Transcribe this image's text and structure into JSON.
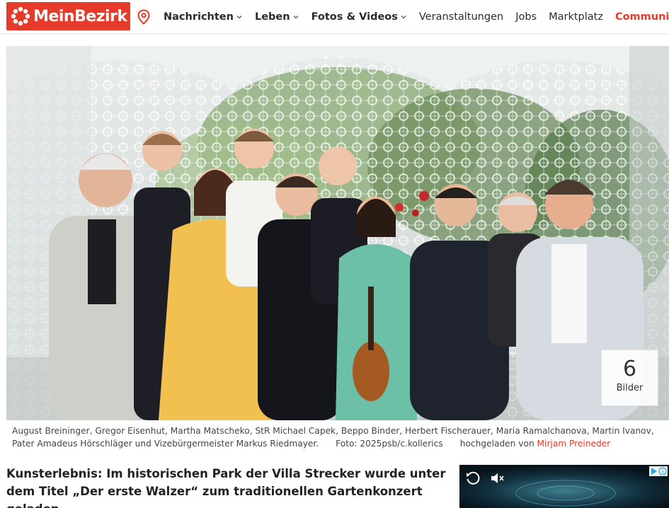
{
  "header": {
    "logo_text": "MeinBezirk",
    "brand_color": "#e63a2a",
    "location_icon": "map-pin-icon",
    "nav": [
      {
        "label": "Nachrichten",
        "dropdown": true,
        "style": "bold"
      },
      {
        "label": "Leben",
        "dropdown": true,
        "style": "bold"
      },
      {
        "label": "Fotos & Videos",
        "dropdown": true,
        "style": "bold"
      },
      {
        "label": "Veranstaltungen",
        "dropdown": false,
        "style": "normal"
      },
      {
        "label": "Jobs",
        "dropdown": false,
        "style": "normal"
      },
      {
        "label": "Marktplatz",
        "dropdown": false,
        "style": "normal"
      },
      {
        "label": "Community",
        "dropdown": true,
        "style": "accent"
      }
    ]
  },
  "gallery": {
    "count": "6",
    "count_label": "Bilder"
  },
  "caption": {
    "text": "August Breininger, Gregor Eisenhut, Martha Matscheko, StR Michael Capek, Beppo Binder, Herbert Fischerauer, Maria Ramalchanova, Martin Ivanov, Pater Amadeus Hörschläger und Vizebürgermeister Markus Riedmayer.",
    "credit": "Foto: 2025psb/c.kollerics",
    "uploaded_prefix": "hochgeladen von",
    "uploader": "Mirjam Preineder"
  },
  "article": {
    "lead": "Kunsterlebnis: Im historischen Park der Villa Strecker wurde unter dem Titel „Der erste Walzer“ zum traditionellen Gartenkonzert geladen."
  },
  "ad": {
    "replay_icon": "replay-icon",
    "mute_icon": "speaker-muted-icon",
    "info_icon": "adchoices-icon"
  }
}
